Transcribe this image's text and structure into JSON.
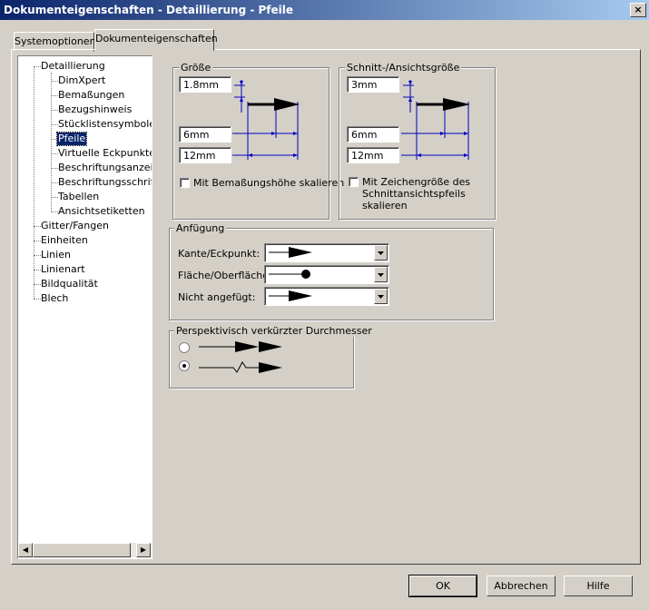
{
  "window": {
    "title": "Dokumenteigenschaften - Detaillierung - Pfeile",
    "close_label": "×"
  },
  "tabs": [
    {
      "label": "Systemoptionen",
      "active": false
    },
    {
      "label": "Dokumenteigenschaften",
      "active": true
    }
  ],
  "tree": {
    "items": [
      {
        "label": "Detaillierung",
        "level": 0
      },
      {
        "label": "DimXpert",
        "level": 1
      },
      {
        "label": "Bemaßungen",
        "level": 1
      },
      {
        "label": "Bezugshinweis",
        "level": 1
      },
      {
        "label": "Stücklistensymbole",
        "level": 1
      },
      {
        "label": "Pfeile",
        "level": 1,
        "selected": true
      },
      {
        "label": "Virtuelle Eckpunkte",
        "level": 1
      },
      {
        "label": "Beschriftungsanzeige",
        "level": 1
      },
      {
        "label": "Beschriftungsschriftart",
        "level": 1
      },
      {
        "label": "Tabellen",
        "level": 1
      },
      {
        "label": "Ansichtsetiketten",
        "level": 1
      },
      {
        "label": "Gitter/Fangen",
        "level": 0
      },
      {
        "label": "Einheiten",
        "level": 0
      },
      {
        "label": "Linien",
        "level": 0
      },
      {
        "label": "Linienart",
        "level": 0
      },
      {
        "label": "Bildqualität",
        "level": 0
      },
      {
        "label": "Blech",
        "level": 0
      }
    ]
  },
  "groesse": {
    "title": "Größe",
    "height_value": "1.8mm",
    "width_value": "6mm",
    "length_value": "12mm",
    "scale_label": "Mit Bemaßungshöhe skalieren",
    "scale_checked": false
  },
  "schnitt": {
    "title": "Schnitt-/Ansichtsgröße",
    "height_value": "3mm",
    "width_value": "6mm",
    "length_value": "12mm",
    "scale_label_line1": "Mit Zeichengröße des",
    "scale_label_line2": "Schnittansichtspfeils",
    "scale_label_line3": "skalieren",
    "scale_checked": false
  },
  "anfuegung": {
    "title": "Anfügung",
    "kante_label": "Kante/Eckpunkt:",
    "flaeche_label": "Fläche/Oberfläche:",
    "nicht_label": "Nicht angefügt:",
    "kante_value": "closed-arrow",
    "flaeche_value": "dot",
    "nicht_value": "closed-arrow"
  },
  "perspektiv": {
    "title": "Perspektivisch verkürzter Durchmesser",
    "selected_option": 2
  },
  "buttons": {
    "ok": "OK",
    "cancel": "Abbrechen",
    "help": "Hilfe"
  },
  "colors": {
    "titlebar_start": "#0a246a",
    "titlebar_end": "#a6caf0",
    "dim_lines": "#0000c0",
    "face": "#d4d0c8"
  }
}
